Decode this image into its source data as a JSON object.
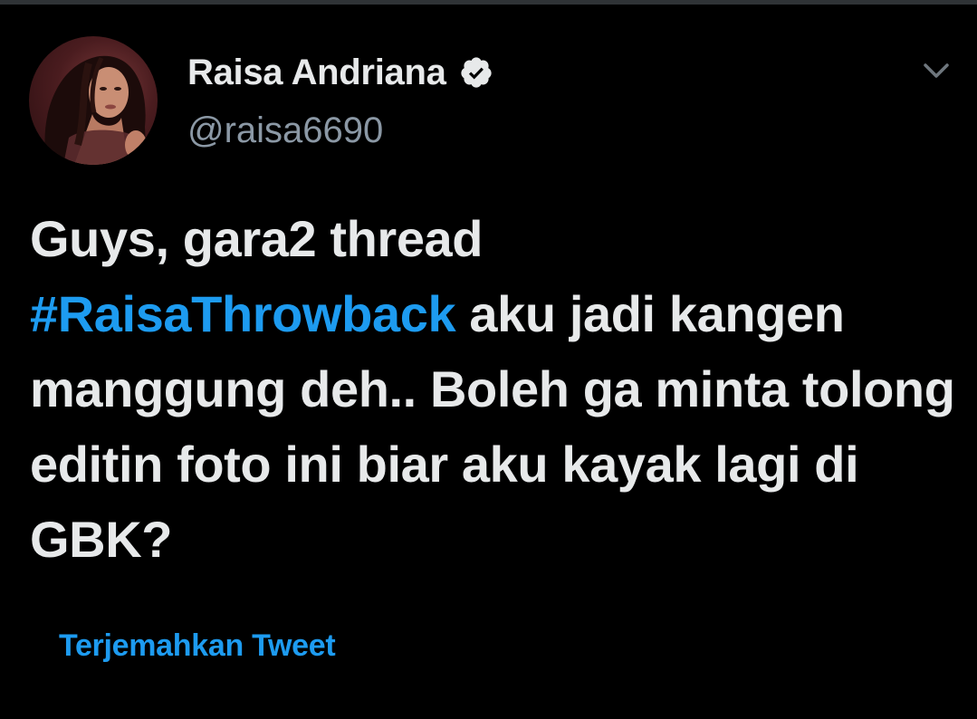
{
  "colors": {
    "background": "#000000",
    "text_primary": "#e7e9ea",
    "text_secondary": "#8b98a5",
    "accent": "#1d9bf0"
  },
  "author": {
    "display_name": "Raisa Andriana",
    "handle": "@raisa6690",
    "verified": true,
    "avatar_icon": "profile-photo"
  },
  "menu": {
    "icon": "chevron-down-icon"
  },
  "tweet": {
    "text_before": "Guys, gara2 thread",
    "hashtag": "#RaisaThrowback",
    "text_after": "aku jadi kangen manggung deh.. Boleh ga minta tolong editin foto ini biar aku kayak lagi di GBK?"
  },
  "translate_label": "Terjemahkan Tweet"
}
